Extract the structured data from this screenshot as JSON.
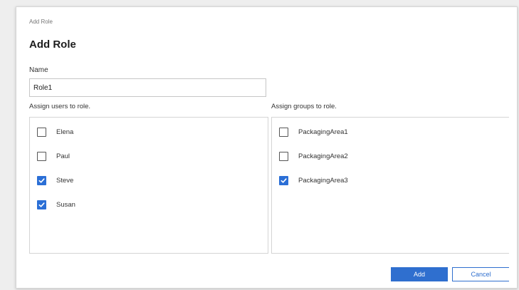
{
  "dialog": {
    "breadcrumb": "Add Role",
    "title": "Add Role",
    "name_label": "Name",
    "name_value": "Role1"
  },
  "users": {
    "label": "Assign users to role.",
    "items": [
      {
        "label": "Elena",
        "checked": false
      },
      {
        "label": "Paul",
        "checked": false
      },
      {
        "label": "Steve",
        "checked": true
      },
      {
        "label": "Susan",
        "checked": true
      }
    ]
  },
  "groups": {
    "label": "Assign groups to role.",
    "items": [
      {
        "label": "PackagingArea1",
        "checked": false
      },
      {
        "label": "PackagingArea2",
        "checked": false
      },
      {
        "label": "PackagingArea3",
        "checked": true
      }
    ]
  },
  "buttons": {
    "add_label": "Add",
    "cancel_label": "Cancel"
  },
  "colors": {
    "accent": "#2f6fcf",
    "checkbox_checked": "#2b6fd6"
  },
  "icons": {
    "checkbox": "check-icon"
  }
}
